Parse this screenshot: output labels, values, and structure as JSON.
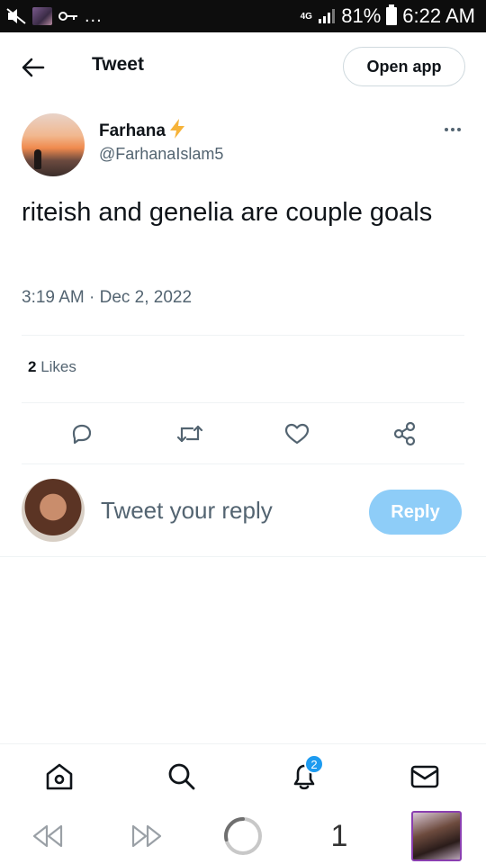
{
  "status_bar": {
    "network": "4G",
    "battery": "81%",
    "time": "6:22 AM",
    "more": "..."
  },
  "header": {
    "title": "Tweet",
    "open_app_label": "Open app"
  },
  "tweet": {
    "author_name": "Farhana",
    "author_emoji": "⚡",
    "author_handle": "@FarhanaIslam5",
    "text": "riteish and genelia are couple goals",
    "timestamp": "3:19 AM · Dec 2, 2022",
    "likes_count": "2",
    "likes_label": " Likes"
  },
  "reply": {
    "placeholder": "Tweet your reply",
    "button_label": "Reply"
  },
  "bottom_nav": {
    "notifications_badge": "2"
  },
  "browser_bar": {
    "tab_count": "1"
  },
  "colors": {
    "accent": "#1d9bf0",
    "reply_button": "#8ecdf8",
    "secondary_text": "#536471"
  }
}
